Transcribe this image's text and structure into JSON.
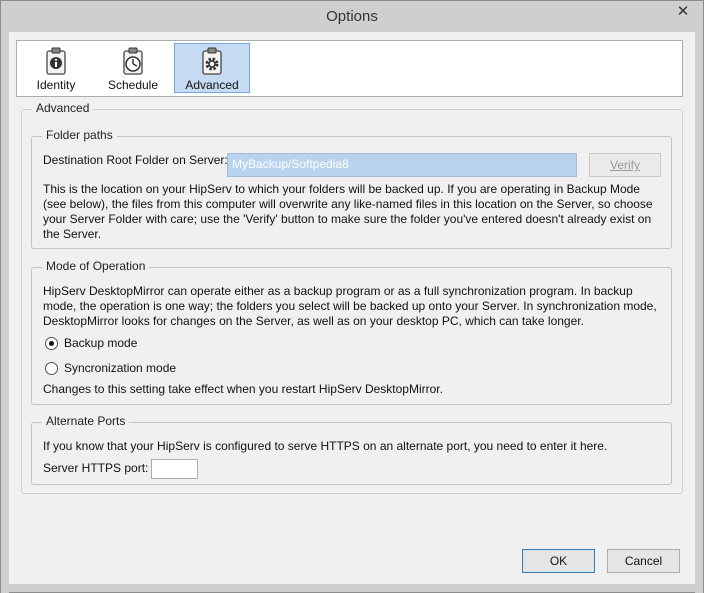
{
  "window": {
    "title": "Options",
    "close_glyph": "✕"
  },
  "toolbar": {
    "tabs": [
      {
        "label": "Identity",
        "icon": "info-clipboard-icon"
      },
      {
        "label": "Schedule",
        "icon": "clock-clipboard-icon"
      },
      {
        "label": "Advanced",
        "icon": "gear-clipboard-icon",
        "selected": true
      }
    ]
  },
  "advanced": {
    "legend": "Advanced",
    "folder_paths": {
      "legend": "Folder paths",
      "dest_label": "Destination Root Folder on Server:",
      "dest_value": "MyBackup/Softpedia8",
      "verify_label": "Verify",
      "description": "This is the location on your HipServ to which your folders will be backed up. If you are operating in Backup Mode (see below), the files from this computer will overwrite any like-named files in this location on the Server, so choose your Server Folder with care; use the 'Verify' button to make sure the folder you've entered doesn't already exist on the Server."
    },
    "mode": {
      "legend": "Mode of Operation",
      "description": "HipServ DesktopMirror can operate either as a backup program or as a full synchronization program. In backup mode, the operation is one way; the folders you select will be backed up onto your Server. In synchronization mode, DesktopMirror looks for changes on the Server, as well as on your desktop PC, which can take longer.",
      "option_backup": "Backup mode",
      "option_sync": "Syncronization mode",
      "selected": "backup",
      "note": "Changes to this setting take effect when you restart HipServ DesktopMirror."
    },
    "ports": {
      "legend": "Alternate Ports",
      "description": "If you know that your HipServ is configured to serve HTTPS on an alternate port, you need to enter it here.",
      "https_label": "Server HTTPS port:",
      "https_value": ""
    }
  },
  "buttons": {
    "ok": "OK",
    "cancel": "Cancel"
  }
}
